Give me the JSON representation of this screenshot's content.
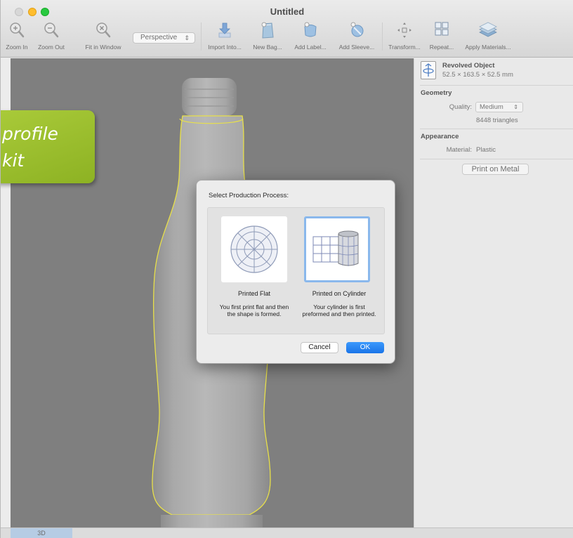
{
  "window": {
    "title": "Untitled"
  },
  "toolbar": {
    "zoom_in": "Zoom In",
    "zoom_out": "Zoom Out",
    "fit_in_window": "Fit in Window",
    "view_mode": "Perspective",
    "import_into": "Import Into...",
    "new_bag": "New Bag...",
    "add_label": "Add Label...",
    "add_sleeve": "Add Sleeve...",
    "transform": "Transform...",
    "repeat": "Repeat...",
    "apply_materials": "Apply Materials..."
  },
  "callout": {
    "text": "profile\nkit"
  },
  "inspector": {
    "object_name": "Revolved Object",
    "object_dims": "52.5 × 163.5 × 52.5 mm",
    "geometry_title": "Geometry",
    "quality_label": "Quality:",
    "quality_value": "Medium",
    "triangles": "8448 triangles",
    "appearance_title": "Appearance",
    "material_label": "Material:",
    "material_value": "Plastic",
    "print_button": "Print on Metal"
  },
  "dialog": {
    "title": "Select Production Process:",
    "options": [
      {
        "title": "Printed Flat",
        "description": "You first print flat and then the shape is formed.",
        "selected": false
      },
      {
        "title": "Printed on Cylinder",
        "description": "Your cylinder is first preformed and then printed.",
        "selected": true
      }
    ],
    "cancel": "Cancel",
    "ok": "OK"
  },
  "bottom": {
    "tab_label": "3D"
  },
  "colors": {
    "accent": "#1a74e8",
    "selection_outline": "#e8e04a",
    "callout": "#9bc02c",
    "viewport": "#7f7f7f"
  }
}
